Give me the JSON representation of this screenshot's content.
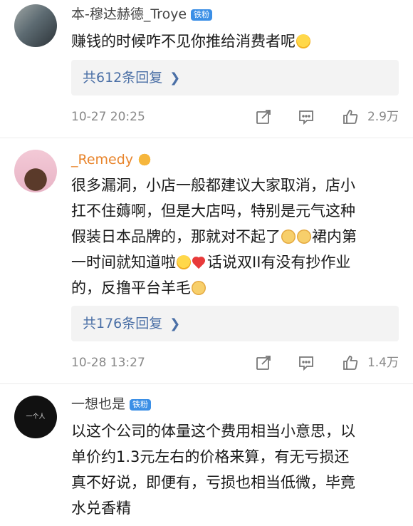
{
  "comments": [
    {
      "username": "本-穆达赫德_Troye",
      "badge": "铁粉",
      "text": "赚钱的时候咋不见你推给消费者呢",
      "emoji_after_text": "yum-face",
      "replies_label": "共612条回复",
      "time": "10-27 20:25",
      "likes": "2.9万"
    },
    {
      "username": "_Remedy",
      "badge_icon": "crown-icon",
      "text_lines": [
        "很多漏洞，小店一般都建议大家取消，店小",
        "扛不住薅啊，但是大店吗，特别是元气这种",
        "假装日本品牌的，那就对不起了",
        "裙内第",
        "一时间就知道啦",
        "话说双II有没有抄作业",
        "的，反撸平台羊毛"
      ],
      "replies_label": "共176条回复",
      "time": "10-28 13:27",
      "likes": "1.4万"
    },
    {
      "username": "一想也是",
      "badge": "铁粉",
      "avatar_text": "一个人",
      "text_lines": [
        "以这个公司的体量这个费用相当小意思，以",
        "单价约1.3元左右的价格来算，有无亏损还",
        "真不好说，即便有，亏损也相当低微，毕竟",
        "水兑香精"
      ]
    }
  ],
  "icons": {
    "repost": "repost-icon",
    "comment": "comment-icon",
    "like": "thumbs-up-icon",
    "chevron": "chevron-right-icon"
  },
  "colors": {
    "badge_blue": "#3b8fe6",
    "link_blue": "#4a6fa6",
    "username_orange": "#e8842b",
    "meta_gray": "#888888"
  }
}
